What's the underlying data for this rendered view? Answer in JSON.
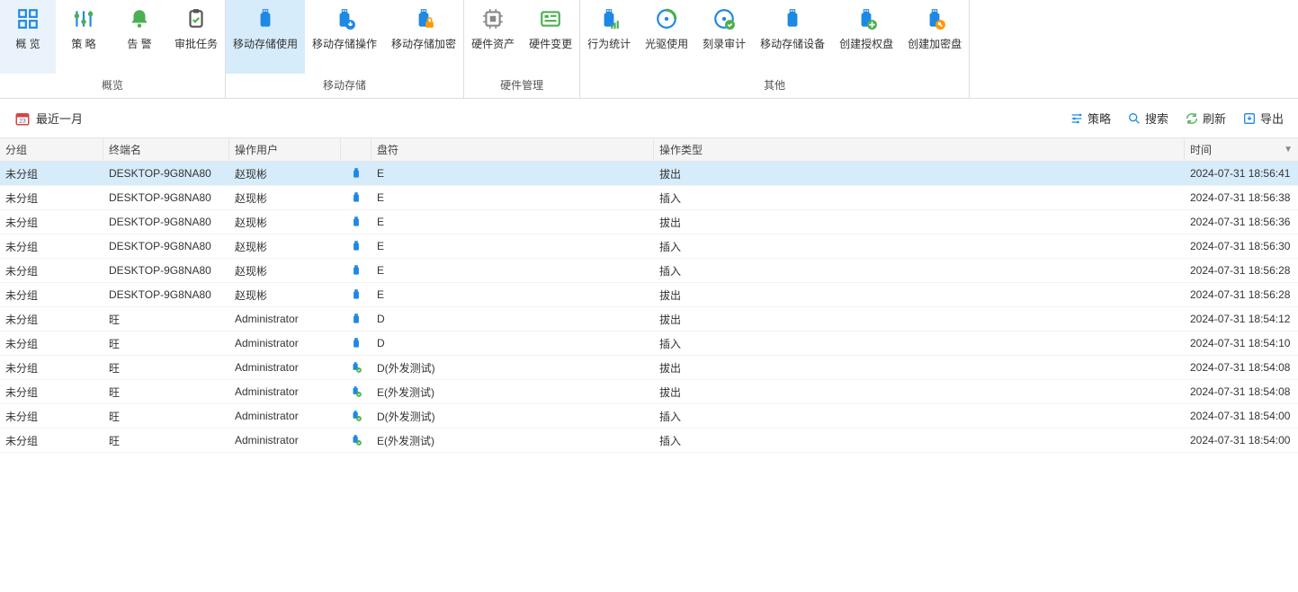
{
  "ribbon": {
    "groups": [
      {
        "label": "概览",
        "items": [
          {
            "id": "overview",
            "label": "概 览",
            "icon": "grid4"
          },
          {
            "id": "policy",
            "label": "策 略",
            "icon": "sliders"
          },
          {
            "id": "alarm",
            "label": "告 警",
            "icon": "bell"
          },
          {
            "id": "approval",
            "label": "审批任务",
            "icon": "clipboard"
          }
        ]
      },
      {
        "label": "移动存储",
        "items": [
          {
            "id": "ms-usage",
            "label": "移动存储使用",
            "icon": "usb",
            "active": true
          },
          {
            "id": "ms-oper",
            "label": "移动存储操作",
            "icon": "usb-down"
          },
          {
            "id": "ms-encrypt",
            "label": "移动存储加密",
            "icon": "usb-lock"
          }
        ]
      },
      {
        "label": "硬件管理",
        "items": [
          {
            "id": "hw-asset",
            "label": "硬件资产",
            "icon": "cpu"
          },
          {
            "id": "hw-change",
            "label": "硬件变更",
            "icon": "board"
          }
        ]
      },
      {
        "label": "其他",
        "items": [
          {
            "id": "behavior",
            "label": "行为统计",
            "icon": "usb-chart"
          },
          {
            "id": "cd-usage",
            "label": "光驱使用",
            "icon": "disc"
          },
          {
            "id": "burn-audit",
            "label": "刻录审计",
            "icon": "disc-check"
          },
          {
            "id": "ms-device",
            "label": "移动存储设备",
            "icon": "usb-plain"
          },
          {
            "id": "auth-disk",
            "label": "创建授权盘",
            "icon": "usb-plus"
          },
          {
            "id": "enc-disk",
            "label": "创建加密盘",
            "icon": "usb-key"
          }
        ]
      }
    ]
  },
  "toolbar": {
    "date_range": "最近一月",
    "actions": {
      "policy": "策略",
      "search": "搜索",
      "refresh": "刷新",
      "export": "导出"
    }
  },
  "grid": {
    "headers": {
      "group": "分组",
      "terminal": "终端名",
      "user": "操作用户",
      "drive": "盘符",
      "optype": "操作类型",
      "time": "时间"
    },
    "rows": [
      {
        "group": "未分组",
        "terminal": "DESKTOP-9G8NA80",
        "user": "赵现彬",
        "dev": "usb",
        "drive": "E",
        "optype": "拔出",
        "time": "2024-07-31 18:56:41",
        "selected": true
      },
      {
        "group": "未分组",
        "terminal": "DESKTOP-9G8NA80",
        "user": "赵现彬",
        "dev": "usb",
        "drive": "E",
        "optype": "插入",
        "time": "2024-07-31 18:56:38"
      },
      {
        "group": "未分组",
        "terminal": "DESKTOP-9G8NA80",
        "user": "赵现彬",
        "dev": "usb",
        "drive": "E",
        "optype": "拔出",
        "time": "2024-07-31 18:56:36"
      },
      {
        "group": "未分组",
        "terminal": "DESKTOP-9G8NA80",
        "user": "赵现彬",
        "dev": "usb",
        "drive": "E",
        "optype": "插入",
        "time": "2024-07-31 18:56:30"
      },
      {
        "group": "未分组",
        "terminal": "DESKTOP-9G8NA80",
        "user": "赵现彬",
        "dev": "usb",
        "drive": "E",
        "optype": "插入",
        "time": "2024-07-31 18:56:28"
      },
      {
        "group": "未分组",
        "terminal": "DESKTOP-9G8NA80",
        "user": "赵现彬",
        "dev": "usb",
        "drive": "E",
        "optype": "拔出",
        "time": "2024-07-31 18:56:28"
      },
      {
        "group": "未分组",
        "terminal": "旺",
        "user": "Administrator",
        "dev": "usb",
        "drive": "D",
        "optype": "拔出",
        "time": "2024-07-31 18:54:12"
      },
      {
        "group": "未分组",
        "terminal": "旺",
        "user": "Administrator",
        "dev": "usb",
        "drive": "D",
        "optype": "插入",
        "time": "2024-07-31 18:54:10"
      },
      {
        "group": "未分组",
        "terminal": "旺",
        "user": "Administrator",
        "dev": "usb-out",
        "drive": "D(外发测试)",
        "optype": "拔出",
        "time": "2024-07-31 18:54:08"
      },
      {
        "group": "未分组",
        "terminal": "旺",
        "user": "Administrator",
        "dev": "usb-out",
        "drive": "E(外发测试)",
        "optype": "拔出",
        "time": "2024-07-31 18:54:08"
      },
      {
        "group": "未分组",
        "terminal": "旺",
        "user": "Administrator",
        "dev": "usb-out",
        "drive": "D(外发测试)",
        "optype": "插入",
        "time": "2024-07-31 18:54:00"
      },
      {
        "group": "未分组",
        "terminal": "旺",
        "user": "Administrator",
        "dev": "usb-out",
        "drive": "E(外发测试)",
        "optype": "插入",
        "time": "2024-07-31 18:54:00"
      }
    ]
  },
  "colors": {
    "accent": "#1e88e5",
    "green": "#4caf50",
    "orange": "#ff9800"
  }
}
